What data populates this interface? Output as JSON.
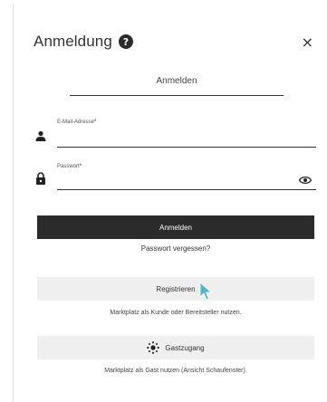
{
  "dialog": {
    "title": "Anmeldung",
    "help_icon": "?",
    "close_icon": "×"
  },
  "tab": {
    "label": "Anmelden"
  },
  "form": {
    "email": {
      "label": "E-Mail-Adresse",
      "required_marker": "*",
      "value": ""
    },
    "password": {
      "label": "Passwort",
      "required_marker": "*",
      "value": ""
    }
  },
  "actions": {
    "login_label": "Anmelden",
    "forgot_password_label": "Passwort vergessen?",
    "register_label": "Registrieren",
    "register_hint": "Marktplatz als Kunde oder Bereitsteller nutzen.",
    "guest_label": "Gastzugang",
    "guest_hint": "Marktplatz als Gast nutzen (Ansicht Schaufenster)."
  },
  "icons": {
    "user": "user-icon",
    "lock": "lock-icon",
    "eye": "eye-icon",
    "guest": "sun-icon",
    "cursor": "cursor-icon"
  },
  "colors": {
    "primary_button": "#2b2b2b",
    "secondary_button": "#efefef",
    "cursor": "#4fb8c9"
  }
}
